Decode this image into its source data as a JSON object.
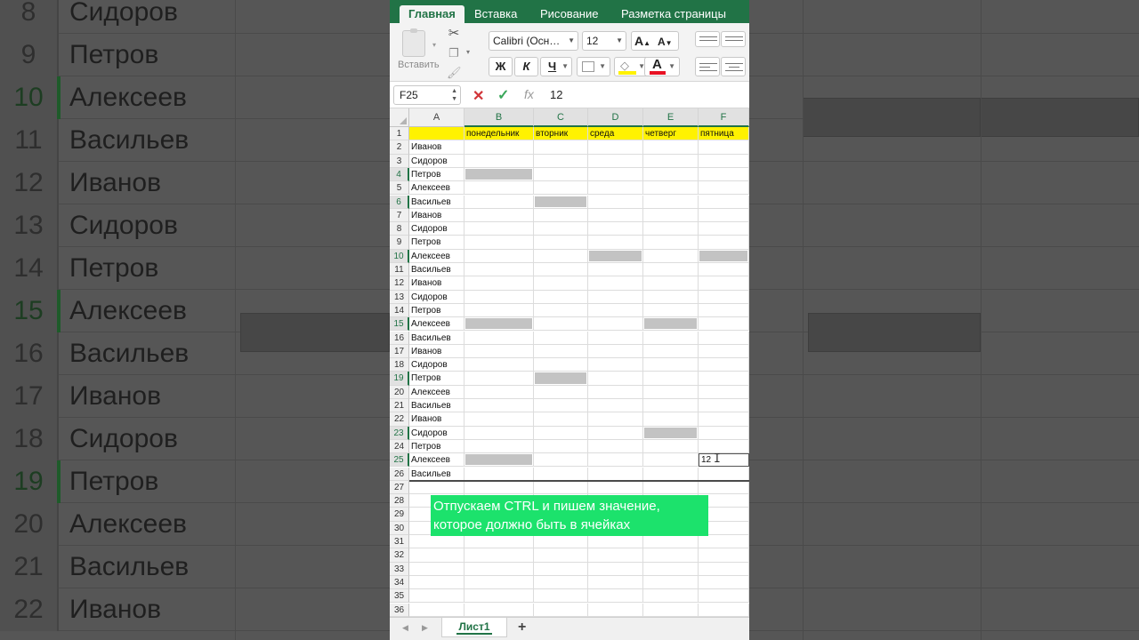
{
  "ribbon_tabs": [
    "Главная",
    "Вставка",
    "Рисование",
    "Разметка страницы"
  ],
  "ribbon": {
    "paste_label": "Вставить",
    "font_name": "Calibri (Осн…",
    "font_size": "12",
    "grow_font": "A",
    "shrink_font": "A",
    "bold": "Ж",
    "italic": "К",
    "underline": "Ч",
    "font_color_letter": "A",
    "icons": [
      "paste-icon",
      "scissors-icon",
      "copy-icon",
      "format-painter-icon",
      "border-icon",
      "fill-color-icon",
      "font-color-icon"
    ]
  },
  "formula_bar": {
    "name_box": "F25",
    "cancel": "✕",
    "enter": "✓",
    "fx": "fx",
    "value": "12"
  },
  "columns": [
    "A",
    "B",
    "C",
    "D",
    "E",
    "F"
  ],
  "header_row": [
    "",
    "понедельник",
    "вторник",
    "среда",
    "четверг",
    "пятница"
  ],
  "names": [
    "Иванов",
    "Сидоров",
    "Петров",
    "Алексеев",
    "Васильев",
    "Иванов",
    "Сидоров",
    "Петров",
    "Алексеев",
    "Васильев",
    "Иванов",
    "Сидоров",
    "Петров",
    "Алексеев",
    "Васильев",
    "Иванов",
    "Сидоров",
    "Петров",
    "Алексеев",
    "Васильев",
    "Иванов",
    "Сидоров",
    "Петров",
    "Алексеев",
    "Васильев"
  ],
  "row_numbers": [
    "1",
    "2",
    "3",
    "4",
    "5",
    "6",
    "7",
    "8",
    "9",
    "10",
    "11",
    "12",
    "13",
    "14",
    "15",
    "16",
    "17",
    "18",
    "19",
    "20",
    "21",
    "22",
    "23",
    "24",
    "25",
    "26",
    "27",
    "28",
    "29",
    "30",
    "31",
    "32",
    "33",
    "34",
    "35",
    "36"
  ],
  "selected_rows": [
    4,
    6,
    10,
    15,
    19,
    23,
    25
  ],
  "highlighted_cells": [
    {
      "row": 4,
      "col": "B"
    },
    {
      "row": 6,
      "col": "C"
    },
    {
      "row": 10,
      "col": "D"
    },
    {
      "row": 10,
      "col": "F"
    },
    {
      "row": 15,
      "col": "B"
    },
    {
      "row": 15,
      "col": "E"
    },
    {
      "row": 19,
      "col": "C"
    },
    {
      "row": 23,
      "col": "E"
    },
    {
      "row": 25,
      "col": "B"
    }
  ],
  "active_cell": {
    "ref": "F25",
    "value": "12"
  },
  "caption": {
    "line1": "Отпускаем CTRL и пишем значение,",
    "line2": "которое должно быть в ячейках"
  },
  "sheet": {
    "tab_name": "Лист1",
    "add": "+"
  },
  "background": {
    "rows": [
      {
        "num": "8",
        "name": "Сидоров",
        "sel": false
      },
      {
        "num": "9",
        "name": "Петров",
        "sel": false
      },
      {
        "num": "10",
        "name": "Алексеев",
        "sel": true
      },
      {
        "num": "11",
        "name": "Васильев",
        "sel": false
      },
      {
        "num": "12",
        "name": "Иванов",
        "sel": false
      },
      {
        "num": "13",
        "name": "Сидоров",
        "sel": false
      },
      {
        "num": "14",
        "name": "Петров",
        "sel": false
      },
      {
        "num": "15",
        "name": "Алексеев",
        "sel": true
      },
      {
        "num": "16",
        "name": "Васильев",
        "sel": false
      },
      {
        "num": "17",
        "name": "Иванов",
        "sel": false
      },
      {
        "num": "18",
        "name": "Сидоров",
        "sel": false
      },
      {
        "num": "19",
        "name": "Петров",
        "sel": true
      },
      {
        "num": "20",
        "name": "Алексеев",
        "sel": false
      },
      {
        "num": "21",
        "name": "Васильев",
        "sel": false
      },
      {
        "num": "22",
        "name": "Иванов",
        "sel": false
      }
    ]
  }
}
